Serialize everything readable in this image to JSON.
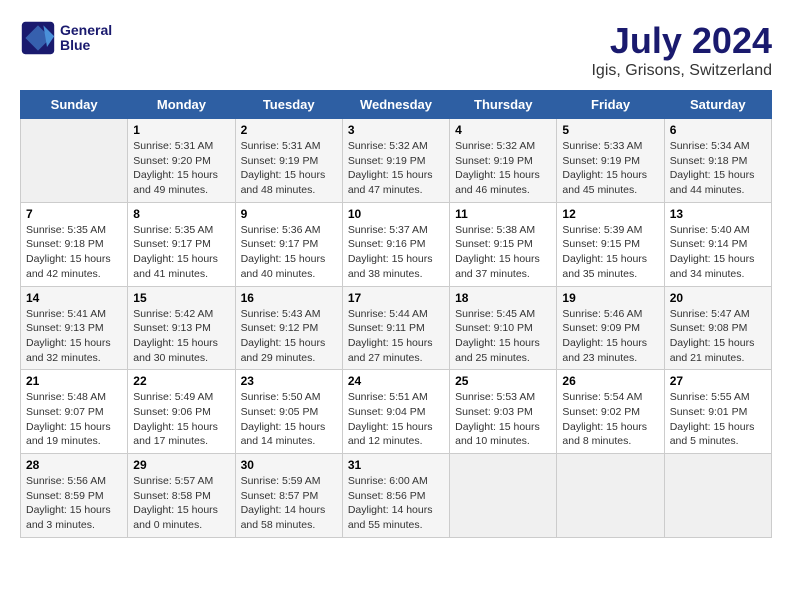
{
  "logo": {
    "line1": "General",
    "line2": "Blue"
  },
  "title": "July 2024",
  "location": "Igis, Grisons, Switzerland",
  "weekdays": [
    "Sunday",
    "Monday",
    "Tuesday",
    "Wednesday",
    "Thursday",
    "Friday",
    "Saturday"
  ],
  "weeks": [
    [
      {
        "day": "",
        "empty": true
      },
      {
        "day": "1",
        "sunrise": "5:31 AM",
        "sunset": "9:20 PM",
        "daylight": "15 hours and 49 minutes."
      },
      {
        "day": "2",
        "sunrise": "5:31 AM",
        "sunset": "9:19 PM",
        "daylight": "15 hours and 48 minutes."
      },
      {
        "day": "3",
        "sunrise": "5:32 AM",
        "sunset": "9:19 PM",
        "daylight": "15 hours and 47 minutes."
      },
      {
        "day": "4",
        "sunrise": "5:32 AM",
        "sunset": "9:19 PM",
        "daylight": "15 hours and 46 minutes."
      },
      {
        "day": "5",
        "sunrise": "5:33 AM",
        "sunset": "9:19 PM",
        "daylight": "15 hours and 45 minutes."
      },
      {
        "day": "6",
        "sunrise": "5:34 AM",
        "sunset": "9:18 PM",
        "daylight": "15 hours and 44 minutes."
      }
    ],
    [
      {
        "day": "7",
        "sunrise": "5:35 AM",
        "sunset": "9:18 PM",
        "daylight": "15 hours and 42 minutes."
      },
      {
        "day": "8",
        "sunrise": "5:35 AM",
        "sunset": "9:17 PM",
        "daylight": "15 hours and 41 minutes."
      },
      {
        "day": "9",
        "sunrise": "5:36 AM",
        "sunset": "9:17 PM",
        "daylight": "15 hours and 40 minutes."
      },
      {
        "day": "10",
        "sunrise": "5:37 AM",
        "sunset": "9:16 PM",
        "daylight": "15 hours and 38 minutes."
      },
      {
        "day": "11",
        "sunrise": "5:38 AM",
        "sunset": "9:15 PM",
        "daylight": "15 hours and 37 minutes."
      },
      {
        "day": "12",
        "sunrise": "5:39 AM",
        "sunset": "9:15 PM",
        "daylight": "15 hours and 35 minutes."
      },
      {
        "day": "13",
        "sunrise": "5:40 AM",
        "sunset": "9:14 PM",
        "daylight": "15 hours and 34 minutes."
      }
    ],
    [
      {
        "day": "14",
        "sunrise": "5:41 AM",
        "sunset": "9:13 PM",
        "daylight": "15 hours and 32 minutes."
      },
      {
        "day": "15",
        "sunrise": "5:42 AM",
        "sunset": "9:13 PM",
        "daylight": "15 hours and 30 minutes."
      },
      {
        "day": "16",
        "sunrise": "5:43 AM",
        "sunset": "9:12 PM",
        "daylight": "15 hours and 29 minutes."
      },
      {
        "day": "17",
        "sunrise": "5:44 AM",
        "sunset": "9:11 PM",
        "daylight": "15 hours and 27 minutes."
      },
      {
        "day": "18",
        "sunrise": "5:45 AM",
        "sunset": "9:10 PM",
        "daylight": "15 hours and 25 minutes."
      },
      {
        "day": "19",
        "sunrise": "5:46 AM",
        "sunset": "9:09 PM",
        "daylight": "15 hours and 23 minutes."
      },
      {
        "day": "20",
        "sunrise": "5:47 AM",
        "sunset": "9:08 PM",
        "daylight": "15 hours and 21 minutes."
      }
    ],
    [
      {
        "day": "21",
        "sunrise": "5:48 AM",
        "sunset": "9:07 PM",
        "daylight": "15 hours and 19 minutes."
      },
      {
        "day": "22",
        "sunrise": "5:49 AM",
        "sunset": "9:06 PM",
        "daylight": "15 hours and 17 minutes."
      },
      {
        "day": "23",
        "sunrise": "5:50 AM",
        "sunset": "9:05 PM",
        "daylight": "15 hours and 14 minutes."
      },
      {
        "day": "24",
        "sunrise": "5:51 AM",
        "sunset": "9:04 PM",
        "daylight": "15 hours and 12 minutes."
      },
      {
        "day": "25",
        "sunrise": "5:53 AM",
        "sunset": "9:03 PM",
        "daylight": "15 hours and 10 minutes."
      },
      {
        "day": "26",
        "sunrise": "5:54 AM",
        "sunset": "9:02 PM",
        "daylight": "15 hours and 8 minutes."
      },
      {
        "day": "27",
        "sunrise": "5:55 AM",
        "sunset": "9:01 PM",
        "daylight": "15 hours and 5 minutes."
      }
    ],
    [
      {
        "day": "28",
        "sunrise": "5:56 AM",
        "sunset": "8:59 PM",
        "daylight": "15 hours and 3 minutes."
      },
      {
        "day": "29",
        "sunrise": "5:57 AM",
        "sunset": "8:58 PM",
        "daylight": "15 hours and 0 minutes."
      },
      {
        "day": "30",
        "sunrise": "5:59 AM",
        "sunset": "8:57 PM",
        "daylight": "14 hours and 58 minutes."
      },
      {
        "day": "31",
        "sunrise": "6:00 AM",
        "sunset": "8:56 PM",
        "daylight": "14 hours and 55 minutes."
      },
      {
        "day": "",
        "empty": true
      },
      {
        "day": "",
        "empty": true
      },
      {
        "day": "",
        "empty": true
      }
    ]
  ]
}
